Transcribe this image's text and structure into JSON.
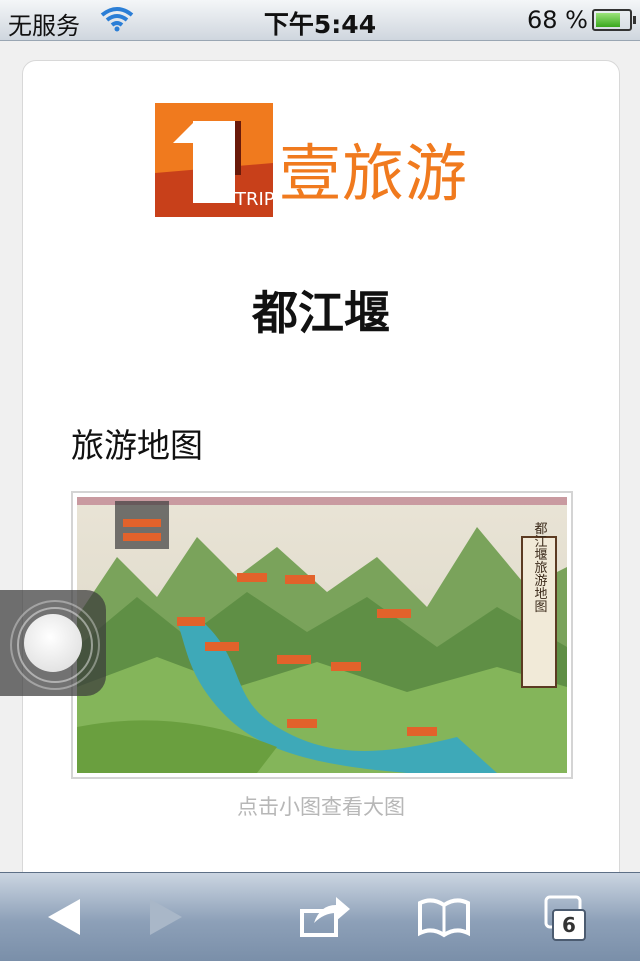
{
  "status_bar": {
    "carrier": "无服务",
    "time": "下午5:44",
    "battery": "68 %",
    "battery_level": 0.68
  },
  "page": {
    "logo_mark_number": "1",
    "logo_mark_sub": "TRIP",
    "logo_text": "壹旅游",
    "title": "都江堰",
    "section_heading": "旅游地图",
    "map_caption": "点击小图查看大图",
    "map_vertical_title": "都江堰旅游地图"
  },
  "toolbar": {
    "tabs_count": "6"
  },
  "colors": {
    "brand_orange": "#f07a1e",
    "logo_red": "#c8401a"
  }
}
